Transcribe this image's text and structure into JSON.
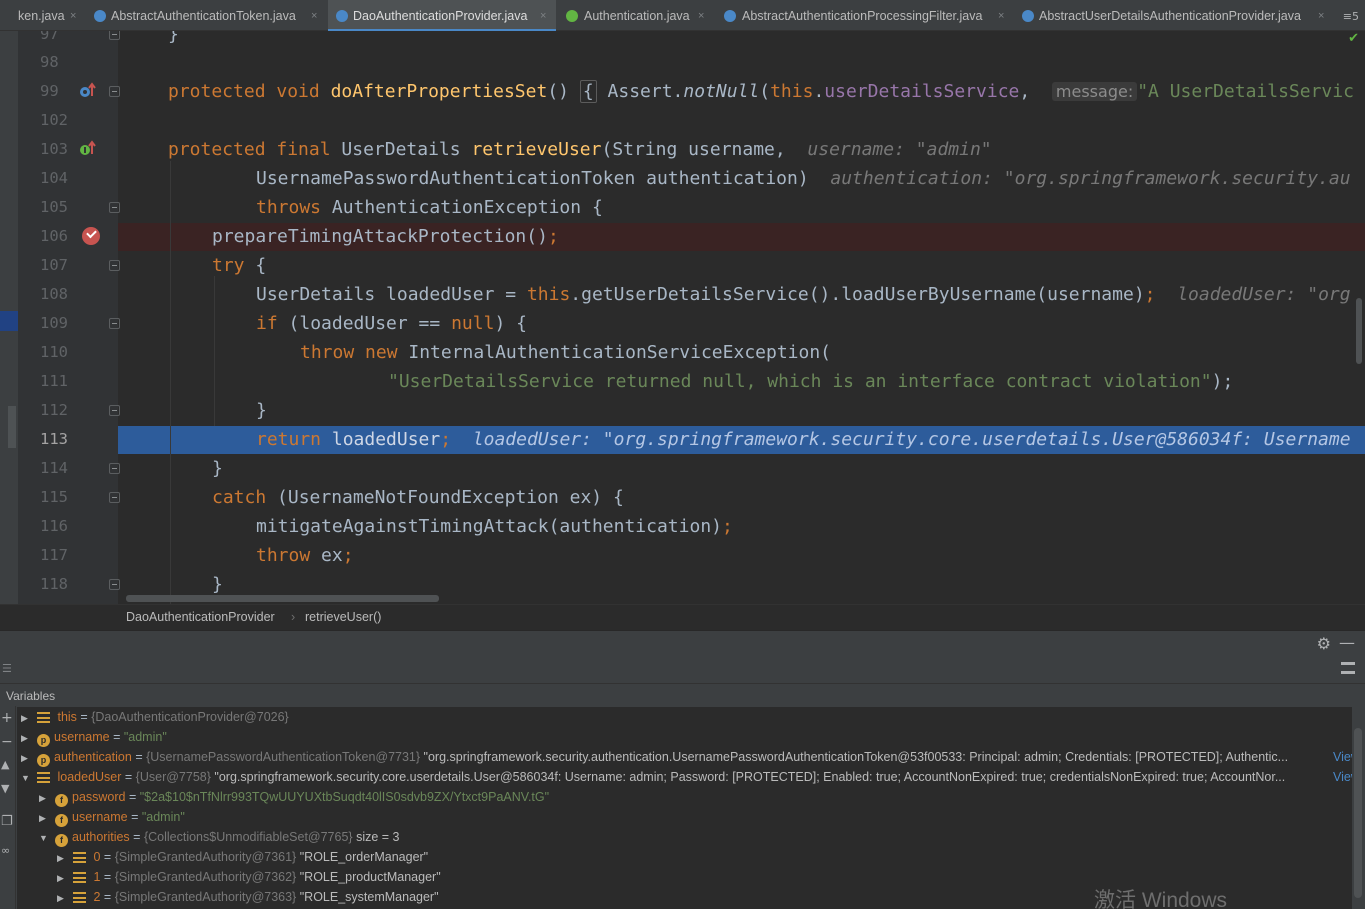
{
  "tabs": [
    {
      "label": "ken.java",
      "icon": "none",
      "active": false
    },
    {
      "label": "AbstractAuthenticationToken.java",
      "icon": "class",
      "active": false
    },
    {
      "label": "DaoAuthenticationProvider.java",
      "icon": "class",
      "active": true
    },
    {
      "label": "Authentication.java",
      "icon": "interface",
      "active": false
    },
    {
      "label": "AbstractAuthenticationProcessingFilter.java",
      "icon": "class",
      "active": false
    },
    {
      "label": "AbstractUserDetailsAuthenticationProvider.java",
      "icon": "class",
      "active": false
    }
  ],
  "tab_close_glyph": "×",
  "tab_overflow_label": "≡5",
  "editor": {
    "line_numbers": [
      "97",
      "98",
      "99",
      "102",
      "103",
      "104",
      "105",
      "106",
      "107",
      "108",
      "109",
      "110",
      "111",
      "112",
      "113",
      "114",
      "115",
      "116",
      "117",
      "118"
    ],
    "current_line": "113",
    "lines": {
      "l97": "}",
      "l99_kw": "protected void ",
      "l99_fn": "doAfterPropertiesSet",
      "l99_paren": "()",
      "l99_brace": "{",
      "l99_assert": " Assert.",
      "l99_notnull": "notNull",
      "l99_open": "(",
      "l99_this": "this",
      "l99_dot": ".",
      "l99_field": "userDetailsService",
      "l99_comma": ", ",
      "l99_msg": "message:",
      "l99_str": "\"A UserDetailsServic",
      "l103_kw": "protected final ",
      "l103_type": "UserDetails ",
      "l103_fn": "retrieveUser",
      "l103_args": "(String username,",
      "l103_hint": "username: \"admin\"",
      "l104_text": "UsernamePasswordAuthenticationToken authentication)",
      "l104_hint": "authentication: \"org.springframework.security.au",
      "l105_kw": "throws ",
      "l105_text": "AuthenticationException {",
      "l106_text": "prepareTimingAttackProtection()",
      "l106_semi": ";",
      "l107_kw": "try ",
      "l107_text": "{",
      "l108_pre": "UserDetails loadedUser = ",
      "l108_this": "this",
      "l108_post": ".getUserDetailsService().loadUserByUsername(username)",
      "l108_semi": ";",
      "l108_hint": "loadedUser: \"org",
      "l109_kw": "if ",
      "l109_pre": "(loadedUser == ",
      "l109_null": "null",
      "l109_post": ") {",
      "l110_kw": "throw new ",
      "l110_text": "InternalAuthenticationServiceException(",
      "l111_str": "\"UserDetailsService returned null, which is an interface contract violation\"",
      "l111_post": ");",
      "l112": "}",
      "l113_kw": "return ",
      "l113_text": "loadedUser",
      "l113_semi": ";",
      "l113_hint": "loadedUser: \"org.springframework.security.core.userdetails.User@586034f: Username",
      "l114": "}",
      "l115_kw": "catch ",
      "l115_text": "(UsernameNotFoundException ex) {",
      "l116_text": "mitigateAgainstTimingAttack(authentication)",
      "l116_semi": ";",
      "l117_kw": "throw ",
      "l117_text": "ex",
      "l117_semi": ";",
      "l118": "}"
    }
  },
  "breadcrumb": {
    "class": "DaoAuthenticationProvider",
    "sep": "›",
    "method": "retrieveUser()"
  },
  "debug": {
    "variables_title": "Variables",
    "vars": [
      {
        "name": "this",
        "type": "{DaoAuthenticationProvider@7026}",
        "value": "",
        "link": ""
      },
      {
        "name": "username",
        "type": "",
        "value": "\"admin\"",
        "link": ""
      },
      {
        "name": "authentication",
        "type": "{UsernamePasswordAuthenticationToken@7731}",
        "value": "\"org.springframework.security.authentication.UsernamePasswordAuthenticationToken@53f00533: Principal: admin; Credentials: [PROTECTED]; Authentic...",
        "link": "View"
      },
      {
        "name": "loadedUser",
        "type": "{User@7758}",
        "value": "\"org.springframework.security.core.userdetails.User@586034f: Username: admin; Password: [PROTECTED]; Enabled: true; AccountNonExpired: true; credentialsNonExpired: true; AccountNor...",
        "link": "View"
      },
      {
        "name": "password",
        "type": "",
        "value": "\"$2a$10$nTfNlrr993TQwUUYUXtbSuqdt40lIS0sdvb9ZX/Ytxct9PaANV.tG\"",
        "link": ""
      },
      {
        "name": "username",
        "type": "",
        "value": "\"admin\"",
        "link": ""
      },
      {
        "name": "authorities",
        "type": "{Collections$UnmodifiableSet@7765}",
        "value": "",
        "size": "size = 3",
        "link": ""
      },
      {
        "name": "0",
        "type": "{SimpleGrantedAuthority@7361}",
        "value": "\"ROLE_orderManager\"",
        "link": ""
      },
      {
        "name": "1",
        "type": "{SimpleGrantedAuthority@7362}",
        "value": "\"ROLE_productManager\"",
        "link": ""
      },
      {
        "name": "2",
        "type": "{SimpleGrantedAuthority@7363}",
        "value": "\"ROLE_systemManager\"",
        "link": ""
      }
    ],
    "equals": " = ",
    "watermark": "激活 Windows"
  },
  "colors": {
    "keyword": "#cc7832",
    "method": "#ffc66d",
    "field": "#9876aa",
    "string": "#6a8759",
    "execution_line": "#2d5c9b",
    "breakpoint_line": "#3a2323",
    "breakpoint": "#c75450"
  }
}
